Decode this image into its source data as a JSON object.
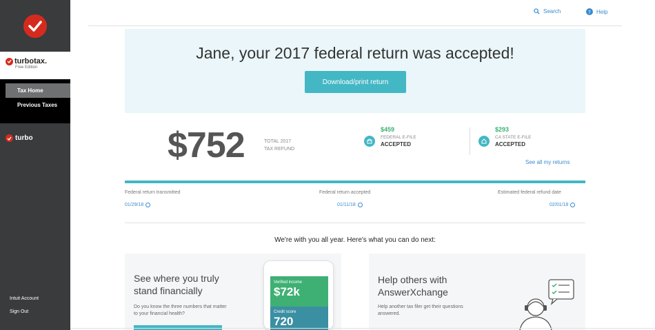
{
  "sidebar": {
    "brand": {
      "name": "turbotax.",
      "edition": "Free Edition"
    },
    "nav": [
      {
        "label": "Tax Home"
      },
      {
        "label": "Previous Taxes"
      }
    ],
    "turbo_label": "turbo",
    "bottom": [
      {
        "label": "Intuit Account"
      },
      {
        "label": "Sign Out"
      }
    ]
  },
  "topbar": {
    "search": "Search",
    "help": "Help"
  },
  "banner": {
    "title": "Jane, your 2017 federal return was accepted!",
    "button": "Download/print return"
  },
  "refund": {
    "amount": "$752",
    "label_line1": "TOTAL 2017",
    "label_line2": "TAX REFUND"
  },
  "statuses": [
    {
      "amount": "$459",
      "sub": "FEDERAL E-FILE",
      "state": "ACCEPTED"
    },
    {
      "amount": "$293",
      "sub": "CA STATE E-FILE",
      "state": "ACCEPTED"
    }
  ],
  "see_all": "See all my returns",
  "progress": [
    {
      "label": "Federal return transmitted",
      "date": "01/29/18"
    },
    {
      "label": "Federal return accepted",
      "date": "01/11/18"
    },
    {
      "label": "Estimated federal refund date",
      "date": "02/01/18"
    }
  ],
  "next_heading": "We're with you all year. Here's what you can do next:",
  "cards": [
    {
      "title_line1": "See where you truly",
      "title_line2": "stand financially",
      "desc_line1": "Do you know the three numbers that matter",
      "desc_line2": "to your financial health?",
      "phone": {
        "income_label": "Verified income",
        "income_value": "$72k",
        "credit_label": "Credit score",
        "credit_value": "720"
      }
    },
    {
      "title_line1": "Help others with",
      "title_line2": "AnswerXchange",
      "desc_line1": "Help another tax filer get their questions",
      "desc_line2": "answered."
    }
  ],
  "colors": {
    "accent": "#43b7c4",
    "brand_red": "#d52b1e",
    "sidebar": "#3a3b3d",
    "success": "#3fb073",
    "link": "#3a8bcf"
  }
}
